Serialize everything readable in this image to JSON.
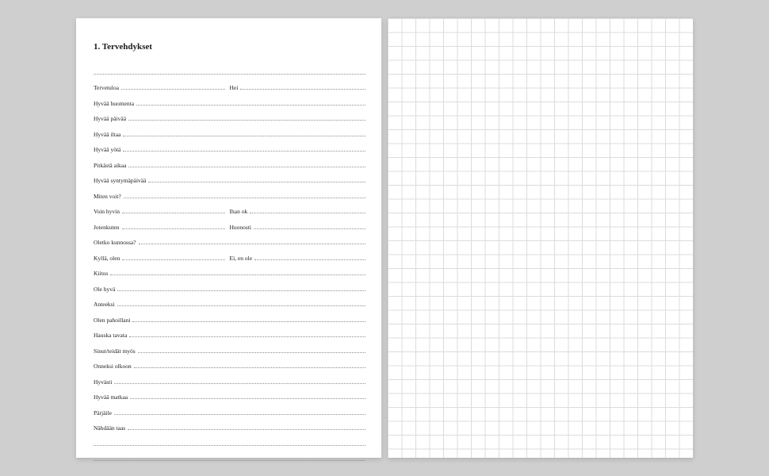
{
  "heading": "1. Tervehdykset",
  "rows": [
    {
      "type": "blank"
    },
    {
      "type": "pair",
      "left": "Tervetuloa",
      "right": "Hei"
    },
    {
      "type": "single",
      "left": "Hyvää huomenta"
    },
    {
      "type": "single",
      "left": "Hyvää päivää"
    },
    {
      "type": "single",
      "left": "Hyvää iltaa"
    },
    {
      "type": "single",
      "left": "Hyvää yötä"
    },
    {
      "type": "single",
      "left": "Pitkästä aikaa"
    },
    {
      "type": "single",
      "left": "Hyvää syntymäpäivää"
    },
    {
      "type": "single",
      "left": "Miten voit?"
    },
    {
      "type": "pair",
      "left": "Voin hyvin",
      "right": "Ihan ok"
    },
    {
      "type": "pair",
      "left": "Jotenkuten",
      "right": "Huonosti"
    },
    {
      "type": "single",
      "left": "Oletko kunnossa?"
    },
    {
      "type": "pair",
      "left": "Kyllä, olen",
      "right": "Ei, en ole"
    },
    {
      "type": "single",
      "left": "Kiitos"
    },
    {
      "type": "single",
      "left": "Ole hyvä"
    },
    {
      "type": "single",
      "left": "Anteeksi"
    },
    {
      "type": "single",
      "left": "Olen pahoillani"
    },
    {
      "type": "single",
      "left": "Hauska tavata"
    },
    {
      "type": "single",
      "left": "Sinut/teidät myös"
    },
    {
      "type": "single",
      "left": "Onneksi olkoon"
    },
    {
      "type": "single",
      "left": "Hyvästi"
    },
    {
      "type": "single",
      "left": "Hyvää matkaa"
    },
    {
      "type": "single",
      "left": "Pärjäile"
    },
    {
      "type": "single",
      "left": "Nähdään taas"
    },
    {
      "type": "blank"
    },
    {
      "type": "blank"
    }
  ]
}
